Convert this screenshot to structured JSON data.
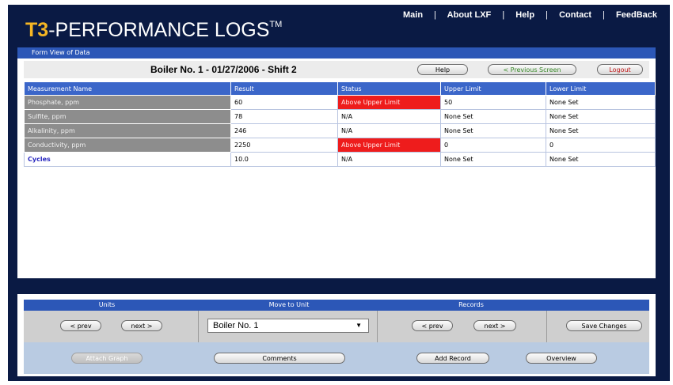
{
  "header": {
    "logo_prefix": "T3",
    "logo_text": "-PERFORMANCE LOGS",
    "logo_tm": "TM",
    "nav": [
      "Main",
      "About LXF",
      "Help",
      "Contact",
      "FeedBack"
    ],
    "nav_separator": "|"
  },
  "panel": {
    "title": "Form View of Data",
    "record_title": "Boiler No. 1 - 01/27/2006 - Shift 2",
    "buttons": {
      "help": "Help",
      "previous": "< Previous Screen",
      "logout": "Logout"
    }
  },
  "table": {
    "headers": [
      "Measurement Name",
      "Result",
      "Status",
      "Upper Limit",
      "Lower Limit"
    ],
    "rows": [
      {
        "name": "Phosphate, ppm",
        "result": "60",
        "status": "Above Upper Limit",
        "upper": "50",
        "lower": "None Set"
      },
      {
        "name": "Sulfite, ppm",
        "result": "78",
        "status": "N/A",
        "upper": "None Set",
        "lower": "None Set"
      },
      {
        "name": "Alkalinity, ppm",
        "result": "246",
        "status": "N/A",
        "upper": "None Set",
        "lower": "None Set"
      },
      {
        "name": "Conductivity, ppm",
        "result": "2250",
        "status": "Above Upper Limit",
        "upper": "0",
        "lower": "0"
      },
      {
        "name": "Cycles",
        "result": "10.0",
        "status": "N/A",
        "upper": "None Set",
        "lower": "None Set"
      }
    ]
  },
  "bottom": {
    "sections": [
      "Units",
      "Move to Unit",
      "Records"
    ],
    "units_prev": "< prev",
    "units_next": "next >",
    "unit_selected": "Boiler No. 1",
    "records_prev": "< prev",
    "records_next": "next >",
    "save_changes": "Save Changes",
    "actions": {
      "disabled_button": "Attach Graph",
      "comments": "Comments",
      "add_record": "Add Record",
      "overview": "Overview"
    }
  },
  "colors": {
    "frame": "#0a1a44",
    "bar_blue": "#2c57b7",
    "alert_red": "#ee1c1c",
    "logo_accent": "#f6b624"
  }
}
